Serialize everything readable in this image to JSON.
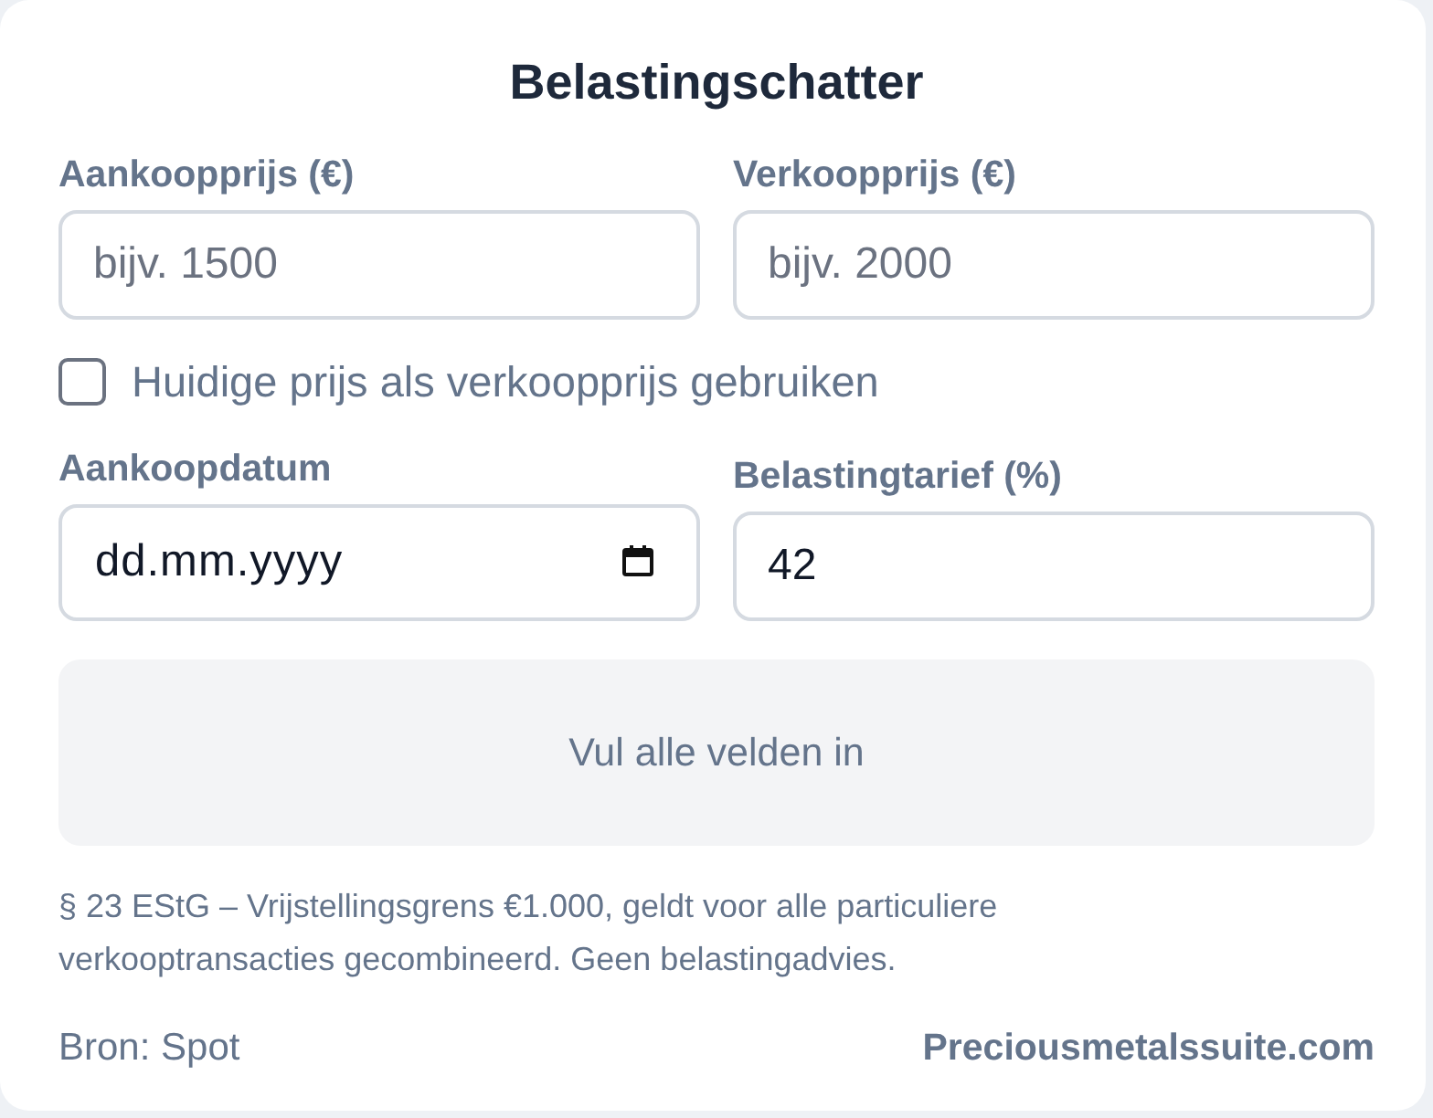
{
  "title": "Belastingschatter",
  "price_fields": [
    {
      "kind": "number",
      "label": "Aankoopprijs (€)",
      "placeholder": "bijv. 1500"
    },
    {
      "kind": "number",
      "label": "Verkoopprijs (€)",
      "placeholder": "bijv. 2000"
    }
  ],
  "use_current_price": {
    "label": "Huidige prijs als verkoopprijs gebruiken",
    "checked": false
  },
  "detail_fields": [
    {
      "kind": "date",
      "label": "Aankoopdatum",
      "placeholder": "dd.mm.yyyy"
    },
    {
      "kind": "number",
      "label": "Belastingtarief (%)",
      "value": "42"
    }
  ],
  "result": "Vul alle velden in",
  "note": "§ 23 EStG – Vrijstellingsgrens €1.000, geldt voor alle particuliere verkooptransacties gecombineerd. Geen belastingadvies.",
  "footer": {
    "source": "Bron: Spot",
    "brand": "Preciousmetalssuite.com"
  }
}
